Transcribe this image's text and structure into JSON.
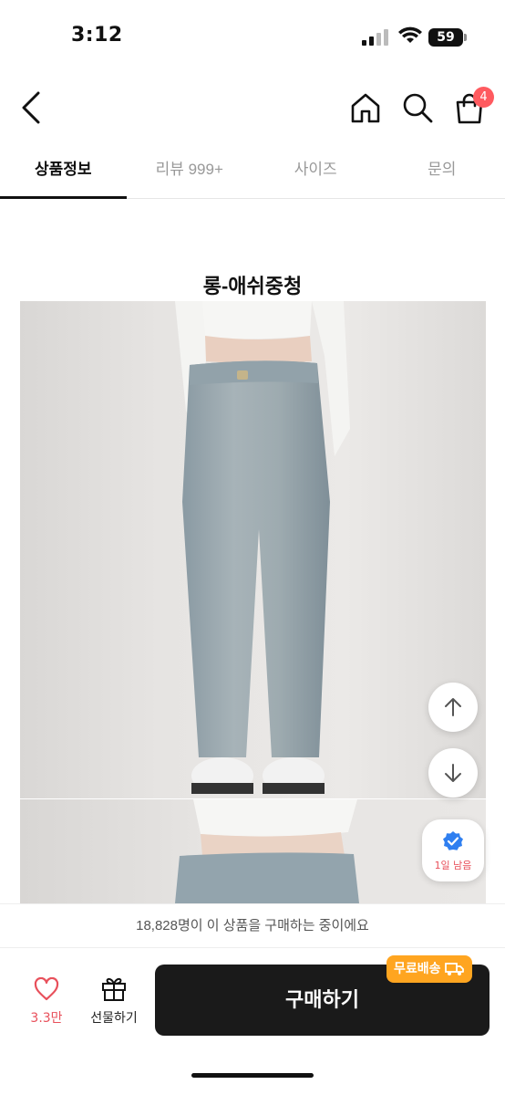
{
  "status_bar": {
    "time": "3:12",
    "battery": "59"
  },
  "nav": {
    "cart_count": "4"
  },
  "tabs": [
    {
      "label": "상품정보",
      "active": true
    },
    {
      "label": "리뷰 999+",
      "active": false
    },
    {
      "label": "사이즈",
      "active": false
    },
    {
      "label": "문의",
      "active": false
    }
  ],
  "product": {
    "title": "롱-애쉬중청"
  },
  "floating": {
    "days_left": "1일 남음"
  },
  "buyers_notice": "18,828명이 이 상품을 구매하는 중이에요",
  "bottom": {
    "like_count": "3.3만",
    "gift_label": "선물하기",
    "buy_label": "구매하기",
    "free_shipping": "무료배송"
  },
  "colors": {
    "accent": "#e8505b",
    "badge": "#ff5a5f",
    "buy_button": "#1a1a1a",
    "free_shipping": "#ffa520"
  }
}
